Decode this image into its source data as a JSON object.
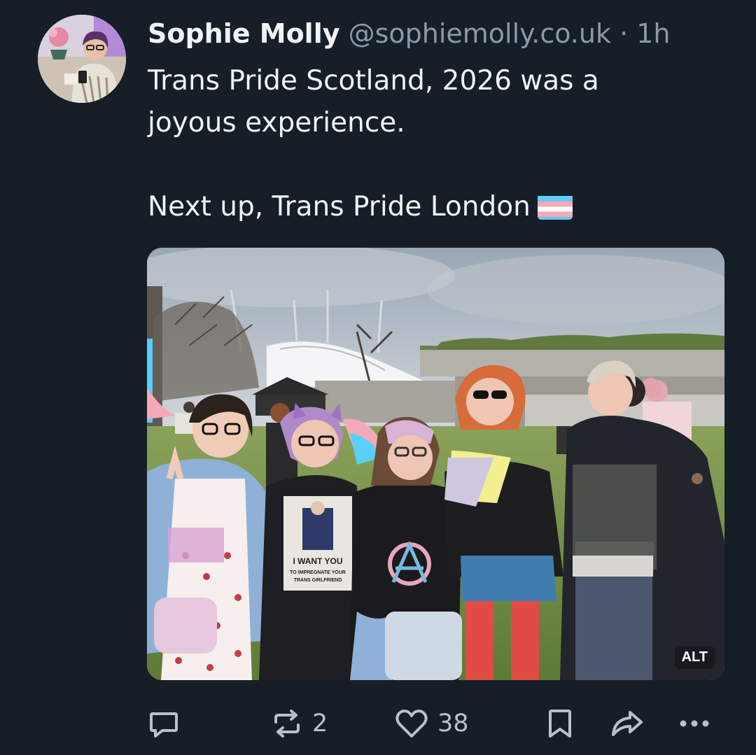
{
  "post": {
    "author_name": "Sophie Molly",
    "handle": "@sophiemolly.co.uk",
    "separator": "·",
    "time": "1h",
    "text": "Trans Pride Scotland, 2026 was a\njoyous experience.\n\nNext up, Trans Pride London",
    "flag_emoji": "transgender-flag",
    "image": {
      "alt_badge": "ALT",
      "shirt_text": [
        "I WANT YOU",
        "TO IMPREGNATE YOUR",
        "TRANS GIRLFRIEND"
      ]
    }
  },
  "actions": {
    "reply_count": "",
    "repost_count": "2",
    "like_count": "38"
  },
  "colors": {
    "background": "#161e27",
    "text_primary": "#f1f3f5",
    "text_secondary": "#8d99a8",
    "icon": "#b8c2cc",
    "flag_blue": "#5bcefa",
    "flag_pink": "#f5a9b8",
    "flag_white": "#ffffff"
  }
}
